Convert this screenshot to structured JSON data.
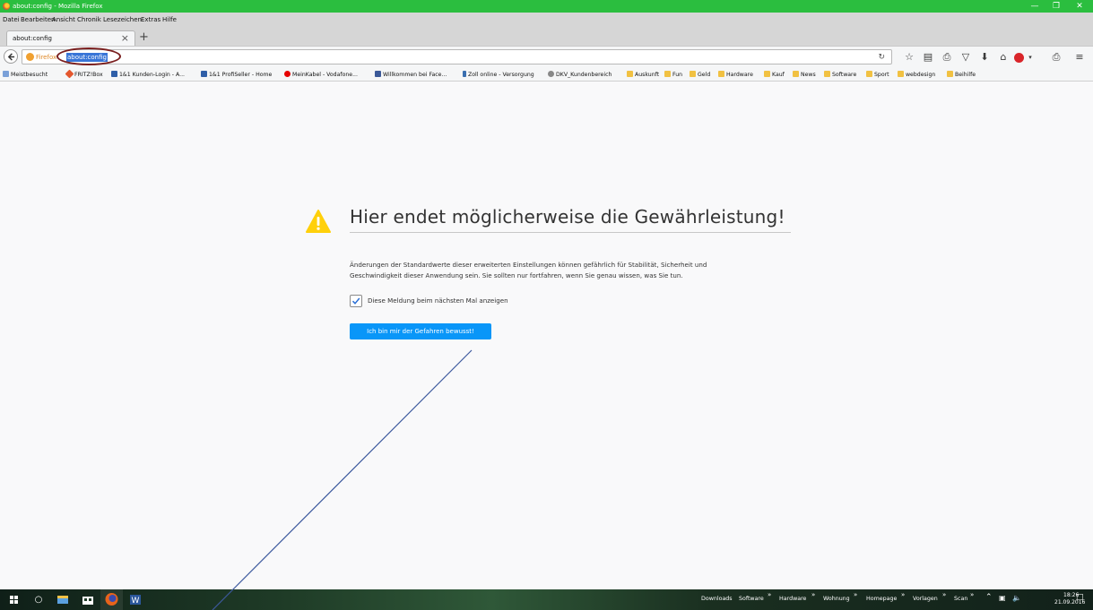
{
  "window": {
    "title": "about:config - Mozilla Firefox",
    "minimize_icon": "minimize-icon",
    "restore_icon": "restore-icon",
    "close_icon": "close-icon"
  },
  "menu": {
    "items": [
      "Datei",
      "Bearbeiten",
      "Ansicht",
      "Chronik",
      "Lesezeichen",
      "Extras",
      "Hilfe"
    ]
  },
  "tabs": [
    {
      "label": "about:config",
      "active": true
    }
  ],
  "navbar": {
    "identity_label": "Firefox",
    "url": "about:config",
    "icons": [
      "reload-icon",
      "bookmark-star-icon",
      "reading-list-icon",
      "print-icon",
      "pocket-icon",
      "download-icon",
      "home-icon",
      "adblock-icon",
      "extension-icon",
      "menu-icon"
    ]
  },
  "bookmarks": [
    {
      "label": "Meistbesucht",
      "icon": "page-icon"
    },
    {
      "label": "FRITZ!Box",
      "icon": "fritz-icon"
    },
    {
      "label": "1&1 Kunden-Login - A...",
      "icon": "site-icon"
    },
    {
      "label": "1&1 ProfiSeller - Home",
      "icon": "site-icon"
    },
    {
      "label": "MeinKabel - Vodafone...",
      "icon": "vodafone-icon"
    },
    {
      "label": "Willkommen bei Face...",
      "icon": "facebook-icon"
    },
    {
      "label": "Zoll online - Versorgung",
      "icon": "site-icon"
    },
    {
      "label": "DKV_Kundenbereich",
      "icon": "globe-icon"
    },
    {
      "label": "Auskunft",
      "icon": "folder-icon"
    },
    {
      "label": "Fun",
      "icon": "folder-icon"
    },
    {
      "label": "Geld",
      "icon": "folder-icon"
    },
    {
      "label": "Hardware",
      "icon": "folder-icon"
    },
    {
      "label": "Kauf",
      "icon": "folder-icon"
    },
    {
      "label": "News",
      "icon": "folder-icon"
    },
    {
      "label": "Software",
      "icon": "folder-icon"
    },
    {
      "label": "Sport",
      "icon": "folder-icon"
    },
    {
      "label": "webdesign",
      "icon": "folder-icon"
    },
    {
      "label": "Beihilfe",
      "icon": "folder-icon"
    }
  ],
  "warning": {
    "title": "Hier endet möglicherweise die Gewährleistung!",
    "body_line1": "Änderungen der Standardwerte dieser erweiterten Einstellungen können gefährlich für Stabilität, Sicherheit und",
    "body_line2": "Geschwindigkeit dieser Anwendung sein. Sie sollten nur fortfahren, wenn Sie genau wissen, was Sie tun.",
    "checkbox_label": "Diese Meldung beim nächsten Mal anzeigen",
    "checkbox_checked": true,
    "button_label": "Ich bin mir der Gefahren bewusst!"
  },
  "taskbar": {
    "pinned": [
      "windows-start-icon",
      "search-circle-icon",
      "file-explorer-icon",
      "store-icon",
      "firefox-icon",
      "word-icon"
    ],
    "toolbars": [
      "Downloads",
      "Software",
      "Hardware",
      "Wohnung",
      "Homepage",
      "Vorlagen",
      "Scan"
    ],
    "time": "18:26",
    "date": "21.09.2016"
  },
  "colors": {
    "titlebar": "#2bbe3f",
    "accent_button": "#0996f8",
    "warning_yellow": "#ffd00b",
    "annotation_line": "#3d5a9e",
    "annotation_oval": "#7a1f1f"
  }
}
